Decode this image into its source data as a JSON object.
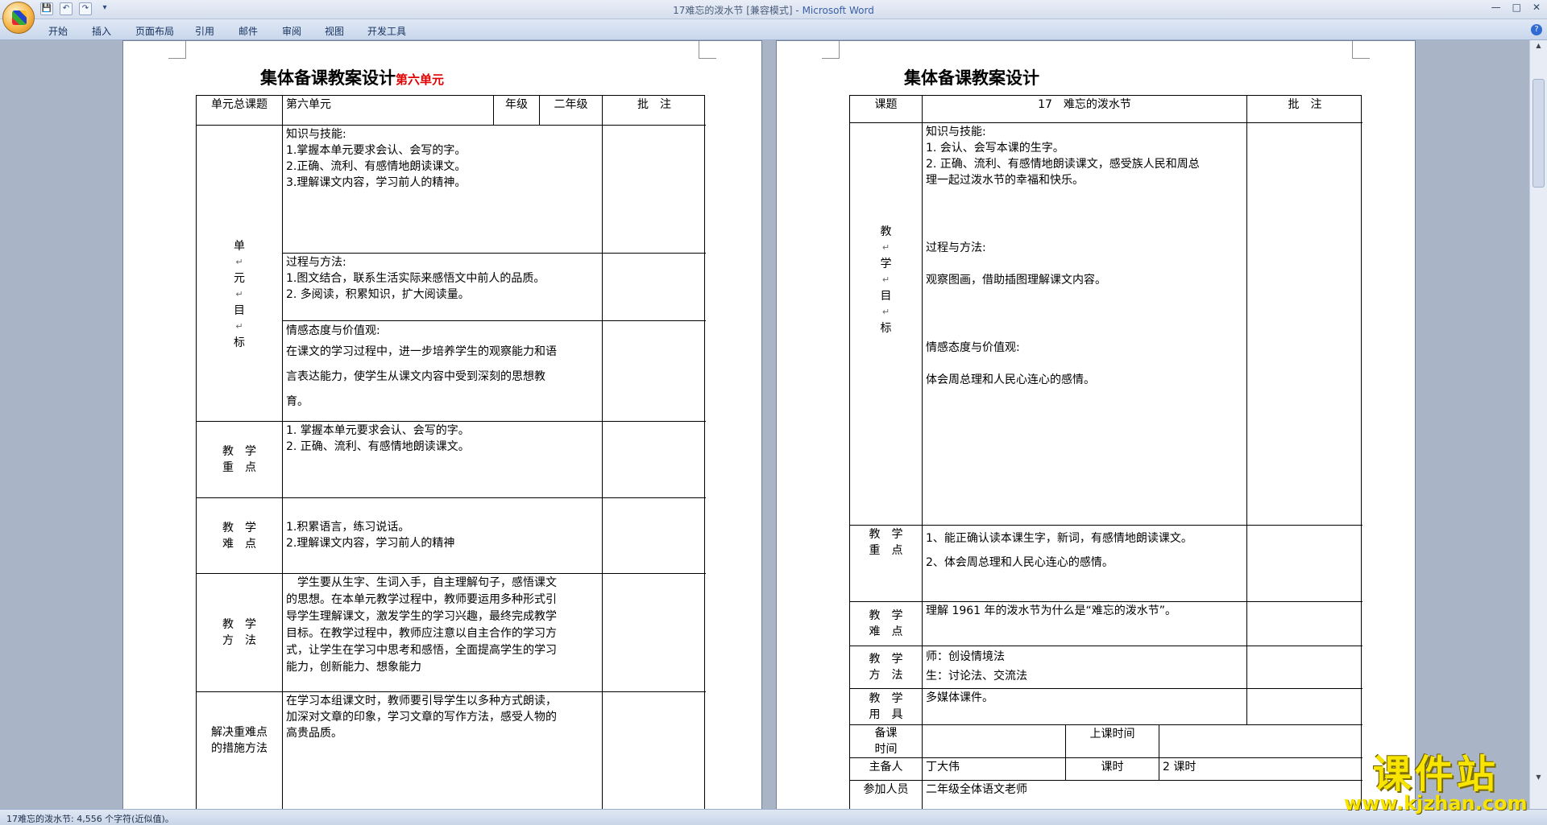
{
  "window": {
    "doc_title": "17难忘的泼水节 [兼容模式] - ",
    "app_name": "Microsoft Word",
    "min": "—",
    "max": "□",
    "close": "✕"
  },
  "qat": {
    "save": "💾",
    "undo": "↶",
    "redo": "↷",
    "more": "▾"
  },
  "ribbon_tabs": [
    "开始",
    "插入",
    "页面布局",
    "引用",
    "邮件",
    "审阅",
    "视图",
    "开发工具"
  ],
  "help": "?",
  "status": {
    "text": "17难忘的泼水节: 4,556 个字符(近似值)。"
  },
  "watermark": {
    "brand": "课件站",
    "url": "www.kjzhan.com"
  },
  "page1": {
    "heading": "集体备课教案设计",
    "heading_red": "第六单元",
    "header": {
      "unit_title_label": "单元总课题",
      "unit_title_value": "第六单元",
      "grade_label": "年级",
      "grade_value": "二年级",
      "notes_label": "批　注"
    },
    "goal_label": [
      "单",
      "元",
      "目",
      "标"
    ],
    "knowledge": [
      "知识与技能:",
      "1.掌握本单元要求会认、会写的字。",
      "2.正确、流利、有感情地朗读课文。",
      "3.理解课文内容，学习前人的精神。"
    ],
    "process": [
      "过程与方法:",
      "1.图文结合，联系生活实际来感悟文中前人的品质。",
      "2. 多阅读，积累知识，扩大阅读量。"
    ],
    "emotion": [
      "情感态度与价值观:",
      "在课文的学习过程中，进一步培养学生的观察能力和语",
      "言表达能力，使学生从课文内容中受到深刻的思想教",
      "育。"
    ],
    "key_label": [
      "教　学",
      "重　点"
    ],
    "key_points": [
      "1.  掌握本单元要求会认、会写的字。",
      "2.  正确、流利、有感情地朗读课文。"
    ],
    "diff_label": [
      "教　学",
      "难　点"
    ],
    "difficulties": [
      "1.积累语言，练习说话。",
      "2.理解课文内容，学习前人的精神"
    ],
    "method_label": [
      "教　学",
      "方　法"
    ],
    "methods": [
      "　学生要从生字、生词入手，自主理解句子，感悟课文",
      "的思想。在本单元教学过程中，教师要运用多种形式引",
      "导学生理解课文，激发学生的学习兴趣，最终完成教学",
      "目标。在教学过程中，教师应注意以自主合作的学习方",
      "式，让学生在学习中思考和感悟，全面提高学生的学习",
      "能力，创新能力、想象能力"
    ],
    "solve_label": [
      "解决重难点",
      "的措施方法"
    ],
    "solve": [
      "在学习本组课文时，教师要引导学生以多种方式朗读，",
      "加深对文章的印象，学习文章的写作方法，感受人物的",
      "高贵品质。"
    ]
  },
  "page2": {
    "heading": "集体备课教案设计",
    "header": {
      "topic_label": "课题",
      "topic_value": "17　难忘的泼水节",
      "notes_label": "批　注"
    },
    "goal_label": [
      "教",
      "学",
      "目",
      "标"
    ],
    "knowledge": [
      "知识与技能:",
      "1.  会认、会写本课的生字。",
      "2.  正确、流利、有感情地朗读课文，感受族人民和周总",
      "理一起过泼水节的幸福和快乐。"
    ],
    "process": [
      "过程与方法:",
      " 观察图画，借助插图理解课文内容。"
    ],
    "emotion": [
      "情感态度与价值观:",
      "体会周总理和人民心连心的感情。"
    ],
    "key_label": [
      "教　学",
      "重　点"
    ],
    "key_points": [
      "1、能正确认读本课生字，新词，有感情地朗读课文。",
      "2、体会周总理和人民心连心的感情。"
    ],
    "diff_label": [
      "教　学",
      "难　点"
    ],
    "difficulty": "理解 1961 年的泼水节为什么是“难忘的泼水节”。",
    "method_label": [
      "教　学",
      "方　法"
    ],
    "methods": [
      "师：创设情境法",
      "生：讨论法、交流法"
    ],
    "tools_label": [
      "教　学",
      "用　具"
    ],
    "tools": "多媒体课件。",
    "prep_label": [
      "备课",
      "时间"
    ],
    "class_time_label": "上课时间",
    "preparer_label": "主备人",
    "preparer": "丁大伟",
    "hours_label": "课时",
    "hours": "2 课时",
    "attendees_label": "参加人员",
    "attendees": "二年级全体语文老师"
  }
}
